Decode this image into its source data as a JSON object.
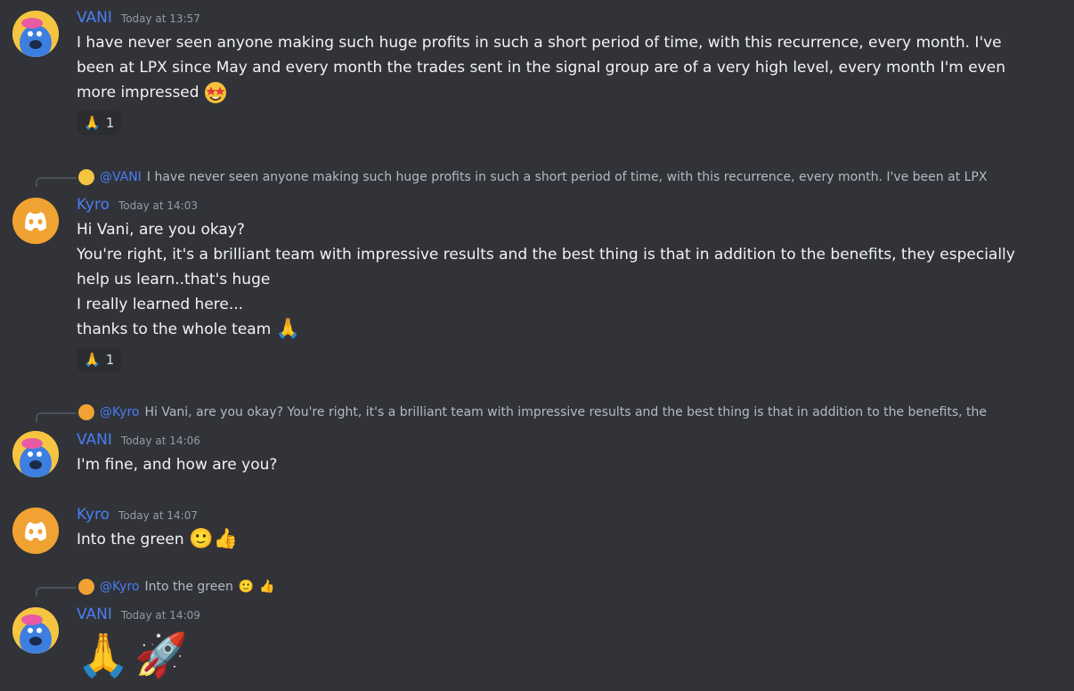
{
  "messages": [
    {
      "user": "VANI",
      "time": "Today at 13:57",
      "lines": [
        "I have never seen anyone making such huge profits in such a short period of time, with this recurrence, every month. I've",
        "been at LPX since May and every month the trades sent in the signal group are of a very high level, every month I'm even",
        "more impressed"
      ],
      "reaction_count": "1"
    },
    {
      "reply_to": "@VANI",
      "reply_text": "I have never seen anyone making such huge profits in such a short period of time, with this recurrence, every month. I've been at LPX",
      "user": "Kyro",
      "time": "Today at 14:03",
      "lines": [
        "Hi Vani, are you okay?",
        "You're right, it's a brilliant team with impressive results and the best thing is that in addition to the benefits, they especially",
        "help us learn..that's huge",
        "I really learned here...",
        "thanks to the whole team"
      ],
      "reaction_count": "1"
    },
    {
      "reply_to": "@Kyro",
      "reply_text": "Hi Vani, are you okay? You're right, it's a brilliant team with impressive results and the best thing is that in addition to the benefits, the",
      "user": "VANI",
      "time": "Today at 14:06",
      "lines": [
        "I'm fine, and how are you?"
      ]
    },
    {
      "user": "Kyro",
      "time": "Today at 14:07",
      "lines": [
        "Into the green"
      ]
    },
    {
      "reply_to": "@Kyro",
      "reply_text": "Into the green",
      "user": "VANI",
      "time": "Today at 14:09",
      "lines": []
    }
  ],
  "colors": {
    "background": "#313338",
    "username": "#4a7df3",
    "timestamp": "#949ba4",
    "text": "#f2f3f5"
  }
}
